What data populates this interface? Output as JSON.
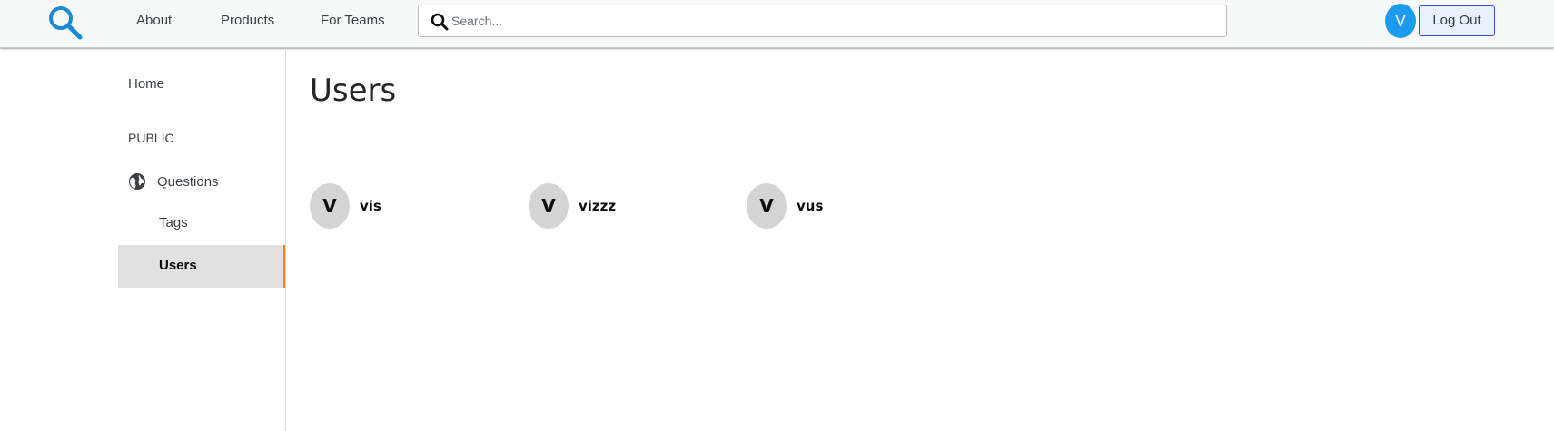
{
  "header": {
    "nav": {
      "about": "About",
      "products": "Products",
      "for_teams": "For Teams"
    },
    "search": {
      "placeholder": "Search...",
      "value": ""
    },
    "user_initial": "V",
    "logout_label": "Log Out"
  },
  "sidebar": {
    "home": "Home",
    "public_heading": "PUBLIC",
    "questions": "Questions",
    "tags": "Tags",
    "users": "Users",
    "active_item": "Users"
  },
  "main": {
    "title": "Users",
    "users": [
      {
        "initial": "V",
        "name": "vis"
      },
      {
        "initial": "V",
        "name": "vizzz"
      },
      {
        "initial": "V",
        "name": "vus"
      }
    ]
  },
  "colors": {
    "accent_blue": "#1a9bf0",
    "active_indicator": "#f48024",
    "logout_border": "#2e4fd0",
    "avatar_gray": "#d4d4d4"
  },
  "icons": [
    "search-logo-icon",
    "search-icon",
    "globe-icon"
  ]
}
